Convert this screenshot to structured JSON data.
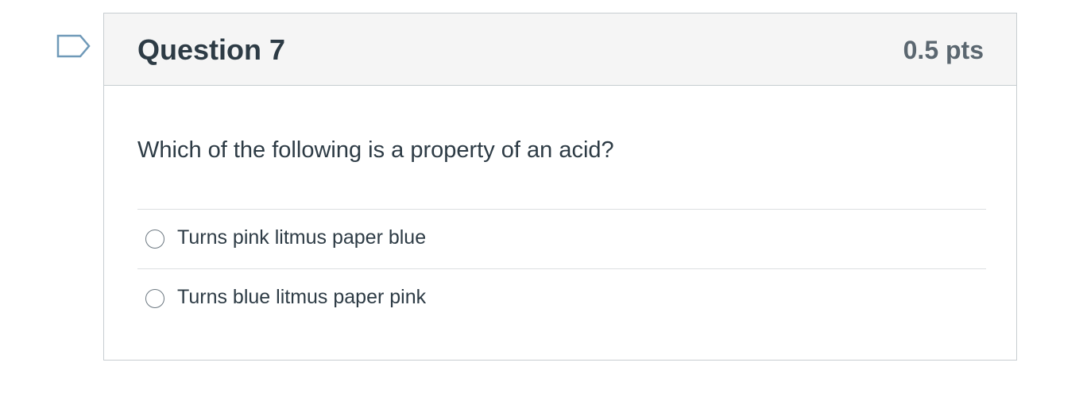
{
  "question": {
    "title": "Question 7",
    "points": "0.5 pts",
    "text": "Which of the following is a property of an acid?",
    "flag_icon": "flag-bookmark-icon",
    "answers": [
      {
        "label": "Turns pink litmus paper blue",
        "selected": false
      },
      {
        "label": "Turns blue litmus paper pink",
        "selected": false
      }
    ]
  },
  "colors": {
    "text": "#2d3b45",
    "points": "#5b6770",
    "header_bg": "#f5f5f5",
    "border": "#c7cdd1",
    "flag": "#6f99b8"
  }
}
